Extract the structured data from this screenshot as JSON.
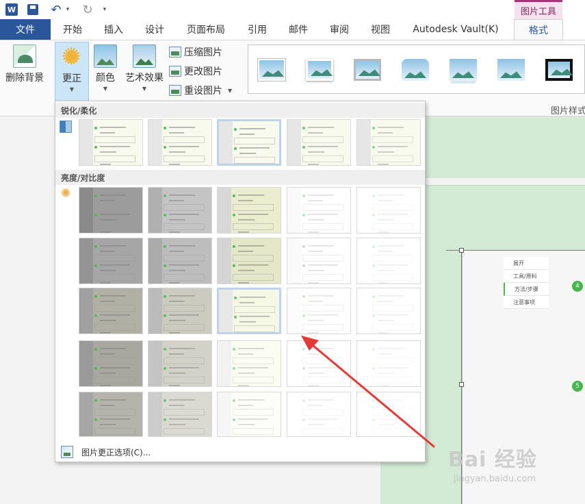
{
  "title_bar": {
    "app_badge": "W",
    "contextual_group": "图片工具"
  },
  "tabs": [
    {
      "label": "文件"
    },
    {
      "label": "开始"
    },
    {
      "label": "插入"
    },
    {
      "label": "设计"
    },
    {
      "label": "页面布局"
    },
    {
      "label": "引用"
    },
    {
      "label": "邮件"
    },
    {
      "label": "审阅"
    },
    {
      "label": "视图"
    },
    {
      "label": "Autodesk Vault(K)"
    },
    {
      "label": "格式"
    }
  ],
  "ribbon": {
    "remove_background": "删除背景",
    "corrections": "更正",
    "color": "颜色",
    "artistic_effects": "艺术效果",
    "compress": "压缩图片",
    "change": "更改图片",
    "reset": "重设图片",
    "styles_group_label": "图片样式"
  },
  "corrections_panel": {
    "sharpen_header": "锐化/柔化",
    "brightness_header": "亮度/对比度",
    "footer_label": "图片更正选项(C)..."
  },
  "document": {
    "side_items": [
      "展开",
      "工具/原料",
      "方法/步骤",
      "注意事项"
    ],
    "step_numbers": [
      "4",
      "5"
    ]
  },
  "watermark": {
    "main": "Bai 经验",
    "sub": "jingyan.baidu.com"
  },
  "colors": {
    "accent": "#2b579a",
    "contextual": "#a5367c",
    "doc_green": "#d3ebd5",
    "step_green": "#46b64f",
    "annotation_red": "#e53935"
  },
  "icons": {
    "word_logo": "word-logo-icon",
    "save": "save-icon",
    "undo": "undo-icon",
    "redo": "redo-icon",
    "sharpen": "sharpen-icon",
    "brightness": "sun-icon",
    "picture_options": "picture-options-icon"
  }
}
